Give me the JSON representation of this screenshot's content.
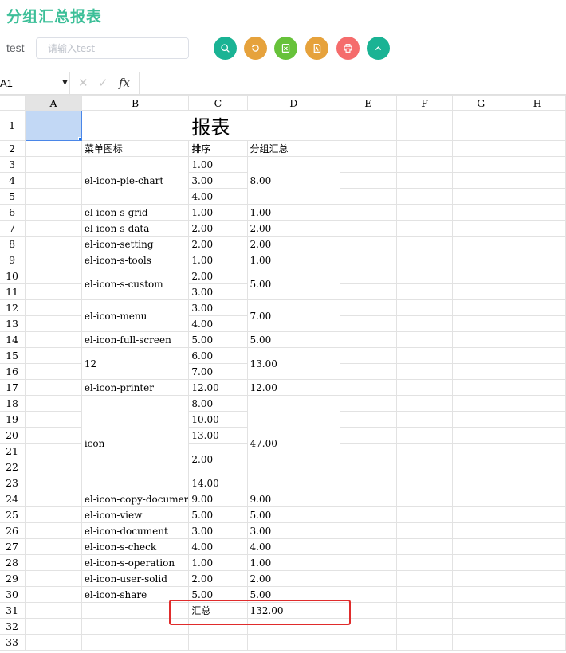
{
  "page": {
    "title": "分组汇总报表"
  },
  "filter": {
    "label": "test",
    "placeholder": "请输入test"
  },
  "buttons": [
    {
      "name": "search-button",
      "icon": "search-icon",
      "color": "#1ab394"
    },
    {
      "name": "reset-button",
      "icon": "refresh-icon",
      "color": "#e6a23c"
    },
    {
      "name": "export-excel-button",
      "icon": "excel-icon",
      "color": "#67c23a"
    },
    {
      "name": "export-pdf-button",
      "icon": "pdf-icon",
      "color": "#e6a23c"
    },
    {
      "name": "print-button",
      "icon": "printer-icon",
      "color": "#f56c6c"
    },
    {
      "name": "collapse-button",
      "icon": "chevron-up-icon",
      "color": "#1ab394"
    }
  ],
  "formula_bar": {
    "cell_ref": "A1",
    "fx": "fx",
    "cancel_icon": "✕",
    "confirm_icon": "✓"
  },
  "sheet": {
    "columns": [
      "A",
      "B",
      "C",
      "D",
      "E",
      "F",
      "G",
      "H"
    ],
    "row_numbers": [
      "1",
      "2",
      "3",
      "4",
      "5",
      "6",
      "7",
      "8",
      "9",
      "10",
      "11",
      "12",
      "13",
      "14",
      "15",
      "16",
      "17",
      "18",
      "19",
      "20",
      "21",
      "22",
      "23",
      "24",
      "25",
      "26",
      "27",
      "28",
      "29",
      "30",
      "31",
      "32",
      "33"
    ],
    "title": "报表",
    "headers": {
      "menu_icon": "菜单图标",
      "sort": "排序",
      "group_total": "分组汇总"
    },
    "groups": [
      {
        "label": "el-icon-pie-chart",
        "sorts": [
          "1.00",
          "3.00",
          "4.00"
        ],
        "total": "8.00"
      },
      {
        "label": "el-icon-s-grid",
        "sorts": [
          "1.00"
        ],
        "total": "1.00"
      },
      {
        "label": "el-icon-s-data",
        "sorts": [
          "2.00"
        ],
        "total": "2.00"
      },
      {
        "label": "el-icon-setting",
        "sorts": [
          "2.00"
        ],
        "total": "2.00"
      },
      {
        "label": "el-icon-s-tools",
        "sorts": [
          "1.00"
        ],
        "total": "1.00"
      },
      {
        "label": "el-icon-s-custom",
        "sorts": [
          "2.00",
          "3.00"
        ],
        "total": "5.00"
      },
      {
        "label": "el-icon-menu",
        "sorts": [
          "3.00",
          "4.00"
        ],
        "total": "7.00"
      },
      {
        "label": "el-icon-full-screen",
        "sorts": [
          "5.00"
        ],
        "total": "5.00"
      },
      {
        "label": "12",
        "sorts": [
          "6.00",
          "7.00"
        ],
        "total": "13.00"
      },
      {
        "label": "el-icon-printer",
        "sorts": [
          "12.00"
        ],
        "total": "12.00"
      },
      {
        "label": "icon",
        "sorts": [
          "8.00",
          "10.00",
          "13.00",
          "2.00",
          "14.00"
        ],
        "sort_spans": [
          1,
          1,
          1,
          2,
          1
        ],
        "total": "47.00"
      },
      {
        "label": "el-icon-copy-documer",
        "sorts": [
          "9.00"
        ],
        "total": "9.00"
      },
      {
        "label": "el-icon-view",
        "sorts": [
          "5.00"
        ],
        "total": "5.00"
      },
      {
        "label": "el-icon-document",
        "sorts": [
          "3.00"
        ],
        "total": "3.00"
      },
      {
        "label": "el-icon-s-check",
        "sorts": [
          "4.00"
        ],
        "total": "4.00"
      },
      {
        "label": "el-icon-s-operation",
        "sorts": [
          "1.00"
        ],
        "total": "1.00"
      },
      {
        "label": "el-icon-user-solid",
        "sorts": [
          "2.00"
        ],
        "total": "2.00"
      },
      {
        "label": "el-icon-share",
        "sorts": [
          "5.00"
        ],
        "total": "5.00"
      }
    ],
    "summary": {
      "label": "汇总",
      "value": "132.00"
    }
  },
  "colors": {
    "accent": "#3cbf98",
    "selection": "#c2d8f5",
    "highlight": "#e02b2b"
  }
}
